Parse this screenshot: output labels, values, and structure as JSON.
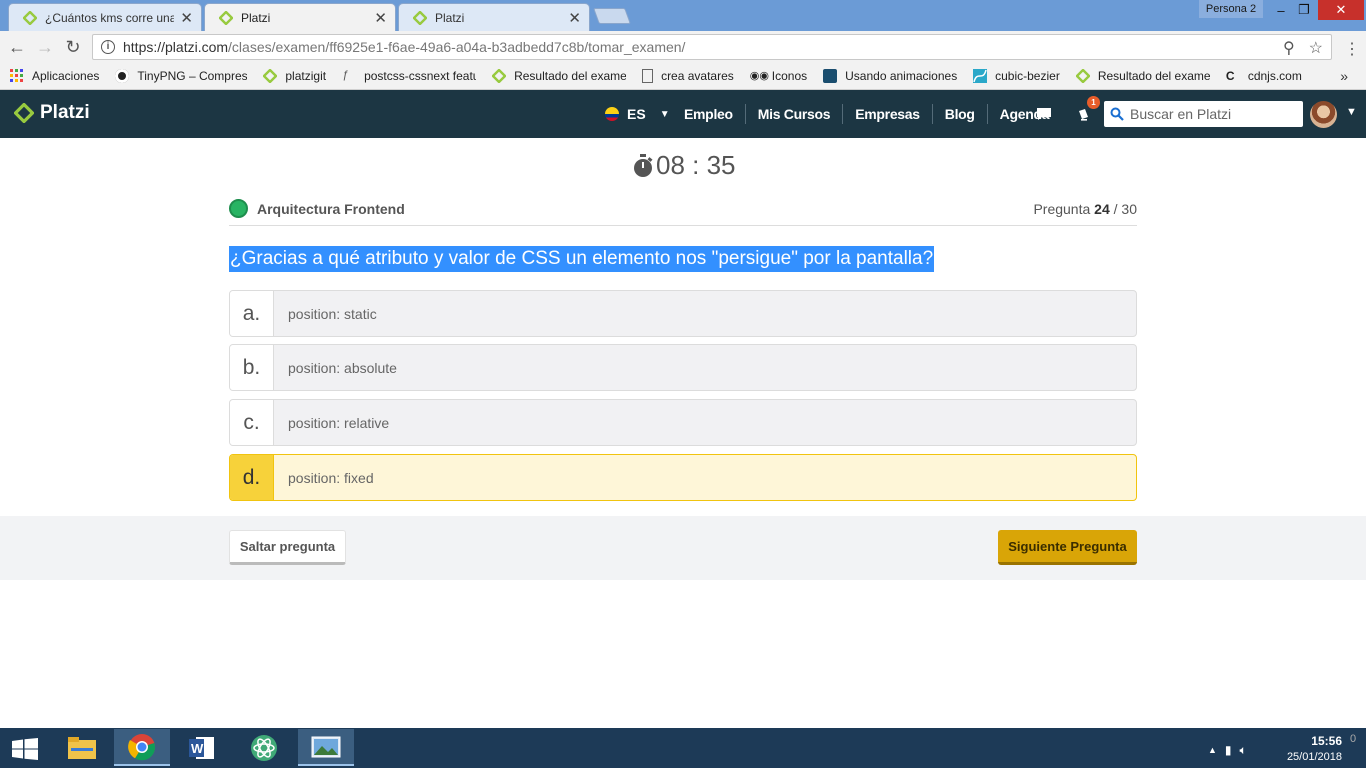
{
  "browser": {
    "tabs": [
      {
        "title": "¿Cuántos kms corre una p",
        "active": false
      },
      {
        "title": "Platzi",
        "active": true
      },
      {
        "title": "Platzi",
        "active": false
      }
    ],
    "profile": "Persona 2",
    "url_host": "https://platzi.com",
    "url_path": "/clases/examen/ff6925e1-f6ae-49a6-a04a-b3adbedd7c8b/tomar_examen/",
    "bookmarks": [
      "Aplicaciones",
      "TinyPNG – Compress",
      "platzigit",
      "postcss-cssnext featu",
      "Resultado del examen",
      "crea avatares",
      "Iconos",
      "Usando animaciones",
      "cubic-bezier",
      "Resultado del examen",
      "cdnjs.com"
    ]
  },
  "header": {
    "logo": "Platzi",
    "lang": "ES",
    "nav": [
      "Empleo",
      "Mis Cursos",
      "Empresas",
      "Blog",
      "Agenda"
    ],
    "notification_count": "1",
    "search_placeholder": "Buscar en Platzi"
  },
  "exam": {
    "timer": "08 : 35",
    "course": "Arquitectura Frontend",
    "question_label": "Pregunta",
    "question_current": "24",
    "question_total": "/ 30",
    "question": "¿Gracias a qué atributo y valor de CSS un elemento nos \"persigue\" por la pantalla?",
    "answers": [
      {
        "letter": "a.",
        "text": "position: static",
        "selected": false
      },
      {
        "letter": "b.",
        "text": "position: absolute",
        "selected": false
      },
      {
        "letter": "c.",
        "text": "position: relative",
        "selected": false
      },
      {
        "letter": "d.",
        "text": "position: fixed",
        "selected": true
      }
    ],
    "skip_label": "Saltar pregunta",
    "next_label": "Siguiente Pregunta"
  },
  "taskbar": {
    "time": "15:56",
    "date": "25/01/2018",
    "notifications": "0"
  },
  "colors": {
    "header_bg": "#1c3643",
    "platzi_green": "#98ca3f",
    "selected_answer": "#f7d23a",
    "next_button": "#d9a507",
    "selection_highlight": "#3390ff"
  }
}
